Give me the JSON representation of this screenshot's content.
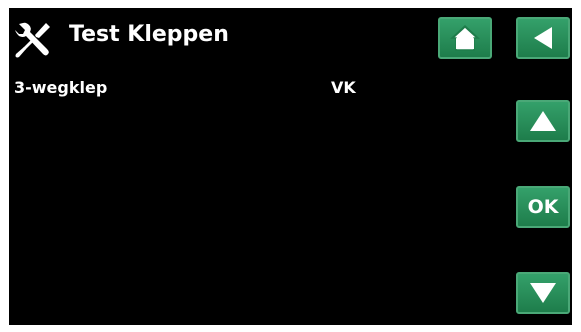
{
  "header": {
    "title": "Test Kleppen",
    "icon": "tools-icon"
  },
  "rows": [
    {
      "label": "3-wegklep",
      "value": "VK"
    }
  ],
  "nav": {
    "home_icon": "home-icon",
    "back_icon": "back-arrow-icon",
    "up_icon": "up-arrow-icon",
    "ok_label": "OK",
    "down_icon": "down-arrow-icon"
  },
  "colors": {
    "background": "#000000",
    "button_green": "#2a8f5c",
    "button_border": "#4aa877",
    "text": "#ffffff"
  }
}
